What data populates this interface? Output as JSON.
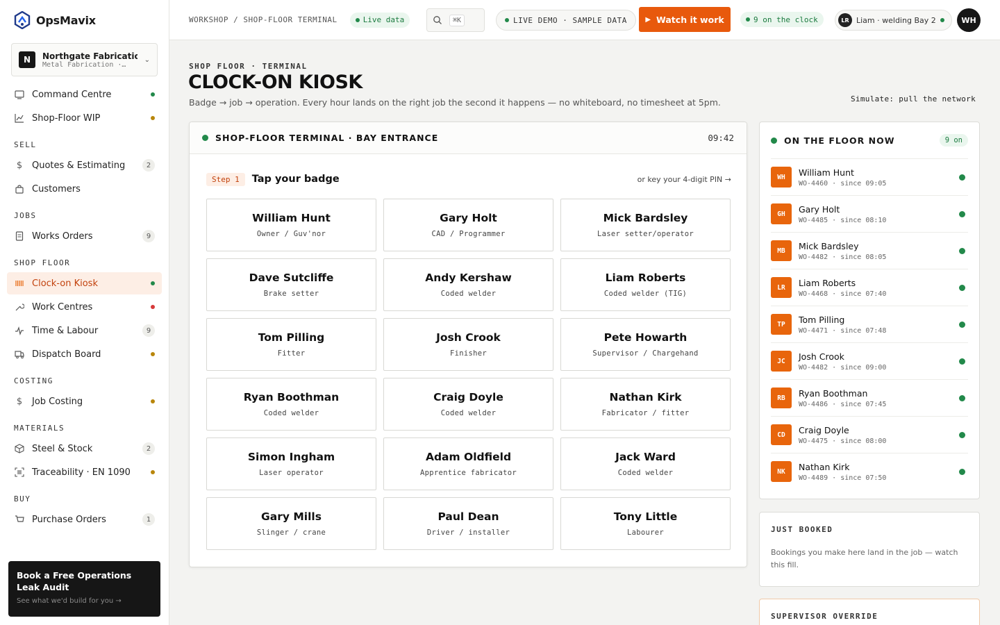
{
  "brand": {
    "name": "OpsMavix"
  },
  "org": {
    "initial": "N",
    "name": "Northgate Fabrication",
    "sub": "Metal Fabrication ·…"
  },
  "colors": {
    "accent": "#e8590c",
    "green": "#22894a",
    "amber": "#b8860b",
    "red": "#d63a3a"
  },
  "nav": {
    "top": [
      {
        "label": "Command Centre",
        "icon": "grid-icon",
        "status": "green"
      },
      {
        "label": "Shop-Floor WIP",
        "icon": "chart-icon",
        "status": "amber"
      }
    ],
    "sections": {
      "sell": {
        "title": "SELL",
        "items": [
          {
            "label": "Quotes & Estimating",
            "icon": "dollar-icon",
            "count": "2"
          },
          {
            "label": "Customers",
            "icon": "bag-icon"
          }
        ]
      },
      "jobs": {
        "title": "JOBS",
        "items": [
          {
            "label": "Works Orders",
            "icon": "document-icon",
            "count": "9"
          }
        ]
      },
      "shop_floor": {
        "title": "SHOP FLOOR",
        "items": [
          {
            "label": "Clock-on Kiosk",
            "icon": "barcode-icon",
            "status": "green"
          },
          {
            "label": "Work Centres",
            "icon": "wrench-icon",
            "status": "red"
          },
          {
            "label": "Time & Labour",
            "icon": "pulse-icon",
            "count": "9"
          },
          {
            "label": "Dispatch Board",
            "icon": "truck-icon",
            "status": "amber"
          }
        ]
      },
      "costing": {
        "title": "COSTING",
        "items": [
          {
            "label": "Job Costing",
            "icon": "dollar-icon",
            "status": "amber"
          }
        ]
      },
      "materials": {
        "title": "MATERIALS",
        "items": [
          {
            "label": "Steel & Stock",
            "icon": "cube-icon",
            "count": "2"
          },
          {
            "label": "Traceability · EN 1090",
            "icon": "scan-icon",
            "status": "amber"
          }
        ]
      },
      "buy": {
        "title": "BUY",
        "items": [
          {
            "label": "Purchase Orders",
            "icon": "cart-icon",
            "count": "1"
          }
        ]
      }
    }
  },
  "promo": {
    "title": "Book a Free Operations Leak Audit",
    "sub": "See what we'd build for you →"
  },
  "topbar": {
    "breadcrumb": "WORKSHOP / SHOP-FLOOR TERMINAL",
    "live": "Live data",
    "search_kbd": "⌘K",
    "demo": "LIVE DEMO · SAMPLE DATA",
    "watch": "Watch it work",
    "on_clock": "9 on the clock",
    "user_initials": "LR",
    "user": "Liam · welding Bay 2",
    "avatar": "WH"
  },
  "page": {
    "kicker": "SHOP FLOOR · TERMINAL",
    "title": "CLOCK-ON KIOSK",
    "subtitle": "Badge → job → operation. Every hour lands on the right job the second it happens — no whiteboard, no timesheet at 5pm.",
    "simulate": "Simulate: pull the network"
  },
  "terminal": {
    "title": "SHOP-FLOOR TERMINAL · BAY ENTRANCE",
    "clock": "09:42",
    "step_badge": "Step 1",
    "step_title": "Tap your badge",
    "pin_link": "or key your 4-digit PIN →",
    "badges": [
      {
        "name": "William Hunt",
        "role": "Owner / Guv'nor"
      },
      {
        "name": "Gary Holt",
        "role": "CAD / Programmer"
      },
      {
        "name": "Mick Bardsley",
        "role": "Laser setter/operator"
      },
      {
        "name": "Dave Sutcliffe",
        "role": "Brake setter"
      },
      {
        "name": "Andy Kershaw",
        "role": "Coded welder"
      },
      {
        "name": "Liam Roberts",
        "role": "Coded welder (TIG)"
      },
      {
        "name": "Tom Pilling",
        "role": "Fitter"
      },
      {
        "name": "Josh Crook",
        "role": "Finisher"
      },
      {
        "name": "Pete Howarth",
        "role": "Supervisor / Chargehand"
      },
      {
        "name": "Ryan Boothman",
        "role": "Coded welder"
      },
      {
        "name": "Craig Doyle",
        "role": "Coded welder"
      },
      {
        "name": "Nathan Kirk",
        "role": "Fabricator / fitter"
      },
      {
        "name": "Simon Ingham",
        "role": "Laser operator"
      },
      {
        "name": "Adam Oldfield",
        "role": "Apprentice fabricator"
      },
      {
        "name": "Jack Ward",
        "role": "Coded welder"
      },
      {
        "name": "Gary Mills",
        "role": "Slinger / crane"
      },
      {
        "name": "Paul Dean",
        "role": "Driver / installer"
      },
      {
        "name": "Tony Little",
        "role": "Labourer"
      }
    ]
  },
  "floor": {
    "title": "ON THE FLOOR NOW",
    "count": "9 on",
    "people": [
      {
        "initials": "WH",
        "name": "William Hunt",
        "meta": "WO-4460 · since 09:05"
      },
      {
        "initials": "GH",
        "name": "Gary Holt",
        "meta": "WO-4485 · since 08:10"
      },
      {
        "initials": "MB",
        "name": "Mick Bardsley",
        "meta": "WO-4482 · since 08:05"
      },
      {
        "initials": "LR",
        "name": "Liam Roberts",
        "meta": "WO-4468 · since 07:40"
      },
      {
        "initials": "TP",
        "name": "Tom Pilling",
        "meta": "WO-4471 · since 07:48"
      },
      {
        "initials": "JC",
        "name": "Josh Crook",
        "meta": "WO-4482 · since 09:00"
      },
      {
        "initials": "RB",
        "name": "Ryan Boothman",
        "meta": "WO-4486 · since 07:45"
      },
      {
        "initials": "CD",
        "name": "Craig Doyle",
        "meta": "WO-4475 · since 08:00"
      },
      {
        "initials": "NK",
        "name": "Nathan Kirk",
        "meta": "WO-4489 · since 07:50"
      }
    ]
  },
  "booked": {
    "title": "JUST BOOKED",
    "text": "Bookings you make here land in the job — watch this fill."
  },
  "override": {
    "title": "SUPERVISOR OVERRIDE"
  }
}
